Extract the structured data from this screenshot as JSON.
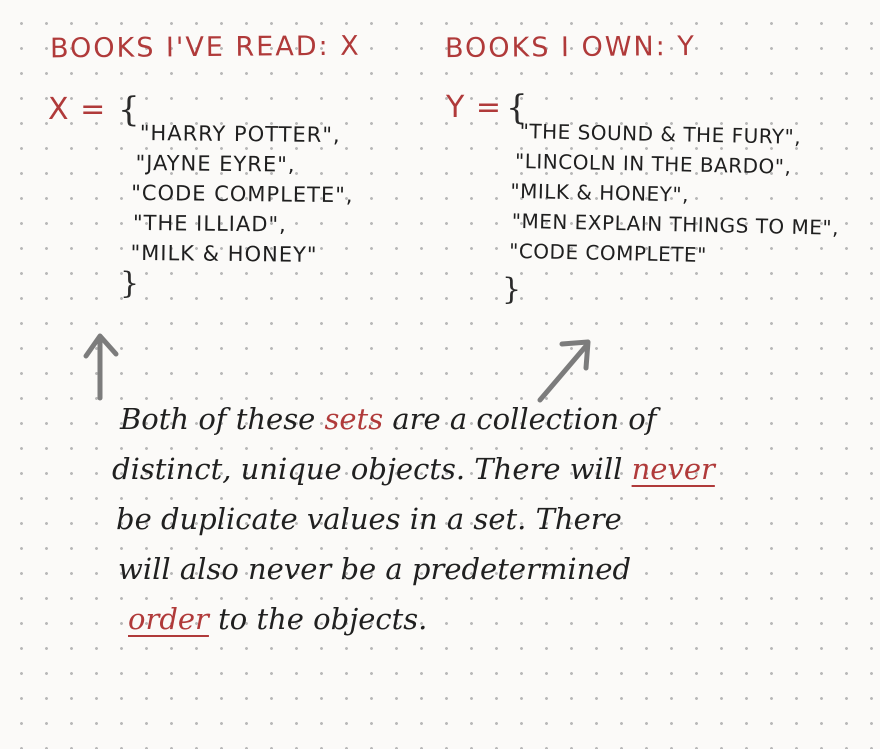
{
  "heading_x": "BOOKS I'VE READ: X",
  "heading_y": "BOOKS I OWN: Y",
  "set_x": {
    "label": "X =",
    "open_brace": "{",
    "close_brace": "}",
    "items": [
      "\"HARRY POTTER\",",
      "\"JAYNE EYRE\",",
      "\"CODE COMPLETE\",",
      "\"THE ILLIAD\",",
      "\"MILK & HONEY\""
    ]
  },
  "set_y": {
    "label": "Y =",
    "open_brace": "{",
    "close_brace": "}",
    "items": [
      "\"THE SOUND & THE FURY\",",
      "\"LINCOLN IN THE BARDO\",",
      "\"MILK & HONEY\",",
      "\"MEN EXPLAIN THINGS TO ME\",",
      "\"CODE COMPLETE\""
    ]
  },
  "note": {
    "line1_a": "Both of these",
    "line1_b": "sets",
    "line1_c": "are a collection of",
    "line2_a": "distinct, unique objects. There will",
    "line2_b": "never",
    "line3": "be duplicate values in a set. There",
    "line4": "will also never be a predetermined",
    "line5_a": "order",
    "line5_b": "to the objects."
  },
  "colors": {
    "red_ink": "#b03a3a",
    "black_ink": "#1f1f1f",
    "arrow_gray": "#7c7c7c",
    "paper": "#fbfaf8",
    "dot_grid": "#b9b9b9"
  },
  "icons": [
    "arrow-up-icon",
    "arrow-up-right-icon"
  ]
}
